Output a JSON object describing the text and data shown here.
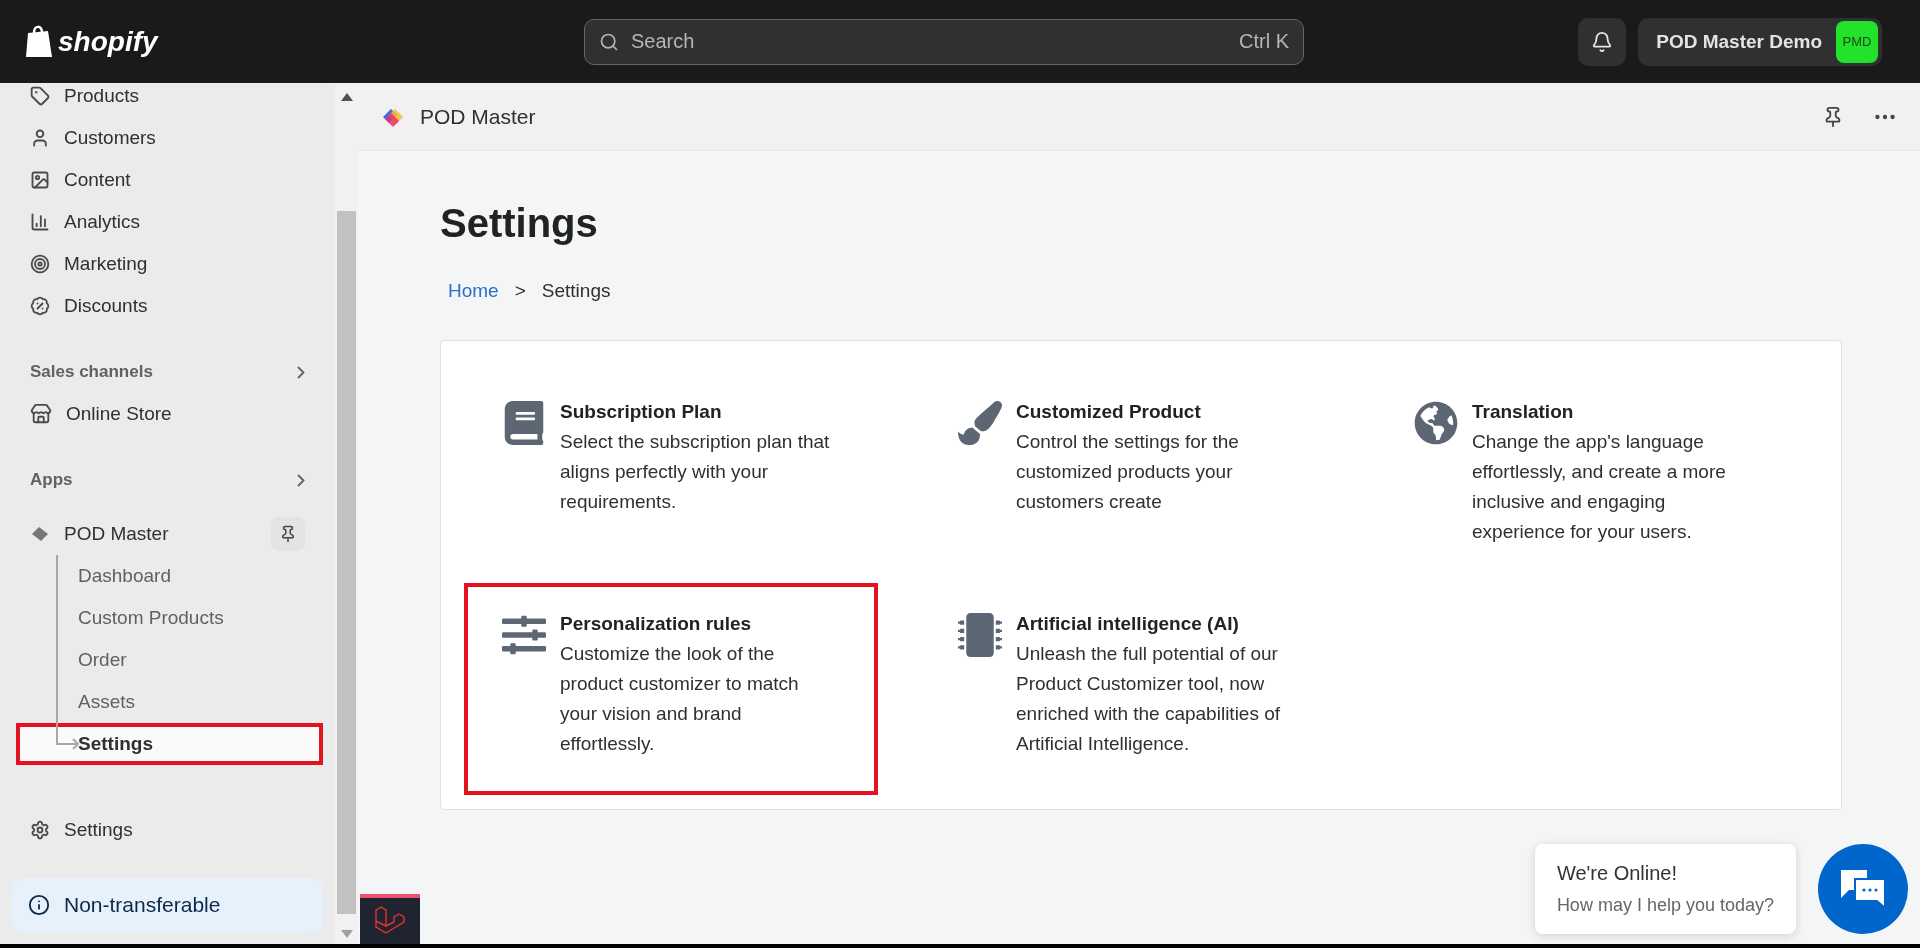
{
  "top_bar": {
    "logo": "shopify",
    "search": {
      "placeholder": "Search",
      "shortcut": "Ctrl K"
    },
    "store_name": "POD Master Demo",
    "avatar": "PMD"
  },
  "sidebar": {
    "nav_items": [
      {
        "label": "Products"
      },
      {
        "label": "Customers"
      },
      {
        "label": "Content"
      },
      {
        "label": "Analytics"
      },
      {
        "label": "Marketing"
      },
      {
        "label": "Discounts"
      }
    ],
    "sales_channels": {
      "title": "Sales channels",
      "items": [
        {
          "label": "Online Store"
        }
      ]
    },
    "apps": {
      "title": "Apps",
      "app": {
        "name": "POD Master",
        "children": [
          {
            "label": "Dashboard",
            "selected": false,
            "highlighted": false
          },
          {
            "label": "Custom Products",
            "selected": false,
            "highlighted": false
          },
          {
            "label": "Order",
            "selected": false,
            "highlighted": false
          },
          {
            "label": "Assets",
            "selected": false,
            "highlighted": false
          },
          {
            "label": "Settings",
            "selected": true,
            "highlighted": true
          }
        ]
      }
    },
    "settings_label": "Settings",
    "notice": "Non-transferable"
  },
  "app_header": {
    "title": "POD Master"
  },
  "page": {
    "title": "Settings",
    "breadcrumb": [
      {
        "label": "Home",
        "kind": "link"
      },
      {
        "label": ">",
        "kind": "separator"
      },
      {
        "label": "Settings",
        "kind": "current"
      }
    ]
  },
  "settings_cards": [
    {
      "title": "Subscription Plan",
      "description": "Select the subscription plan that aligns perfectly with your requirements.",
      "highlighted": false
    },
    {
      "title": "Customized Product",
      "description": "Control the settings for the customized products your customers create",
      "highlighted": false
    },
    {
      "title": "Translation",
      "description": "Change the app's language effortlessly, and create a more inclusive and engaging experience for your users.",
      "highlighted": false
    },
    {
      "title": "Personalization rules",
      "description": "Customize the look of the product customizer to match your vision and brand effortlessly.",
      "highlighted": true
    },
    {
      "title": "Artificial intelligence (AI)",
      "description": "Unleash the full potential of our Product Customizer tool, now enriched with the capabilities of Artificial Intelligence.",
      "highlighted": false
    }
  ],
  "chat_widget": {
    "title": "We're Online!",
    "subtitle": "How may I help you today?"
  }
}
